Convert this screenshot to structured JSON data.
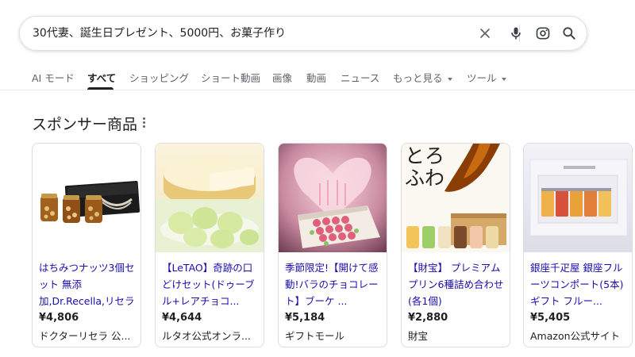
{
  "search": {
    "query": "30代妻、誕生日プレゼント、5000円、お菓子作り"
  },
  "tabs": [
    {
      "label": "AI モード"
    },
    {
      "label": "すべて"
    },
    {
      "label": "ショッピング"
    },
    {
      "label": "ショート動画"
    },
    {
      "label": "画像"
    },
    {
      "label": "動画"
    },
    {
      "label": "ニュース"
    },
    {
      "label": "もっと見る"
    },
    {
      "label": "ツール"
    }
  ],
  "sponsored": {
    "title": "スポンサー商品"
  },
  "products": [
    {
      "title": "はちみつナッツ3個セット 無添加,Dr.Recella,リセラ",
      "price": "¥4,806",
      "seller": "ドクターリセラ 公..."
    },
    {
      "title": "【LeTAO】奇跡の口どけセット(ドゥーブル+レアチョコ...",
      "price": "¥4,644",
      "seller": "ルタオ公式オンラ..."
    },
    {
      "title": "季節限定!【開けて感動!バラのチョコレート】ブーケ ...",
      "price": "¥5,184",
      "seller": "ギフトモール"
    },
    {
      "title": "【財宝】 プレミアムプリン6種詰め合わせ(各1個)",
      "price": "¥2,880",
      "seller": "財宝"
    },
    {
      "title": "銀座千疋屋 銀座フルーツコンポート(5本) ギフト フルー...",
      "price": "¥5,405",
      "seller": "Amazon公式サイト"
    }
  ],
  "image_text": {
    "pudding_logo": "とろふわ"
  },
  "colors": {
    "link": "#1a0dab",
    "text": "#202124",
    "muted": "#5f6368",
    "border": "#dadce0"
  }
}
